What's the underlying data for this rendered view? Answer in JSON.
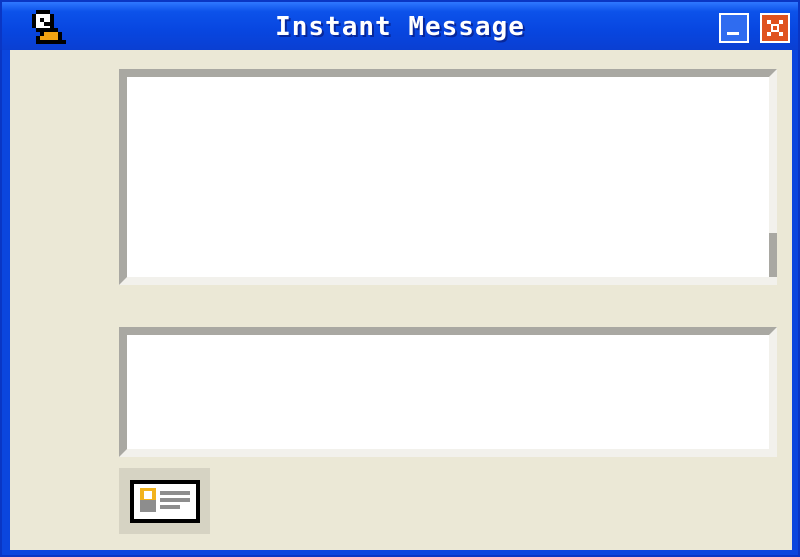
{
  "window": {
    "title": "Instant Message",
    "app_icon": "buddy-icon",
    "controls": {
      "minimize_icon": "minimize-icon",
      "close_icon": "close-icon"
    }
  },
  "history": {
    "text": ""
  },
  "compose": {
    "text": ""
  },
  "toolbar": {
    "contact_card_icon": "contact-card-icon"
  },
  "colors": {
    "titlebar": "#0846e0",
    "client": "#ebe8d6",
    "close_button": "#e0521e",
    "minimize_button": "#2f6cf0"
  }
}
